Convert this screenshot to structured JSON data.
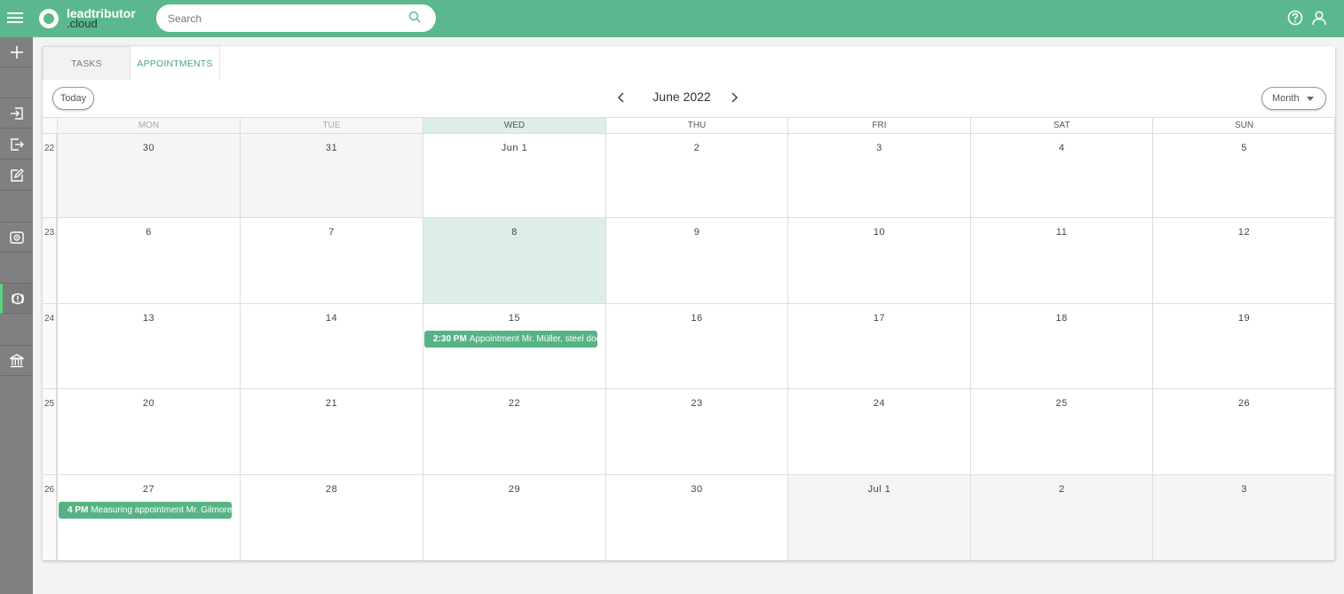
{
  "app": {
    "brand_line1": "leadtributor",
    "brand_line2": ".cloud",
    "brand_color": "#5bb88e"
  },
  "search": {
    "placeholder": "Search"
  },
  "icons": {
    "menu": "hamburger-icon",
    "search": "search-icon",
    "help": "help-icon",
    "user": "user-icon"
  },
  "sidebar": {
    "items": [
      {
        "icon": "plus-icon"
      },
      {
        "icon": "login-icon"
      },
      {
        "icon": "logout-icon"
      },
      {
        "icon": "edit-icon"
      },
      {
        "icon": "eye-icon"
      },
      {
        "icon": "alert-icon",
        "active": true
      },
      {
        "icon": "bank-icon"
      }
    ]
  },
  "tabs": {
    "tasks": "TASKS",
    "appointments": "APPOINTMENTS"
  },
  "toolbar": {
    "today": "Today",
    "title": "June 2022",
    "view": "Month"
  },
  "weekdays": [
    "MON",
    "TUE",
    "WED",
    "THU",
    "FRI",
    "SAT",
    "SUN"
  ],
  "weeks": [
    {
      "num": "22",
      "days": [
        "30",
        "31",
        "Jun 1",
        "2",
        "3",
        "4",
        "5"
      ]
    },
    {
      "num": "23",
      "days": [
        "6",
        "7",
        "8",
        "9",
        "10",
        "11",
        "12"
      ]
    },
    {
      "num": "24",
      "days": [
        "13",
        "14",
        "15",
        "16",
        "17",
        "18",
        "19"
      ]
    },
    {
      "num": "25",
      "days": [
        "20",
        "21",
        "22",
        "23",
        "24",
        "25",
        "26"
      ]
    },
    {
      "num": "26",
      "days": [
        "27",
        "28",
        "29",
        "30",
        "Jul 1",
        "2",
        "3"
      ]
    }
  ],
  "events": [
    {
      "week": 2,
      "day": 2,
      "time": "2:30 PM",
      "title": "Appointment Mr. Müller, steel doors"
    },
    {
      "week": 4,
      "day": 0,
      "time": "4 PM",
      "title": "Measuring appointment Mr. Gilmore"
    }
  ]
}
